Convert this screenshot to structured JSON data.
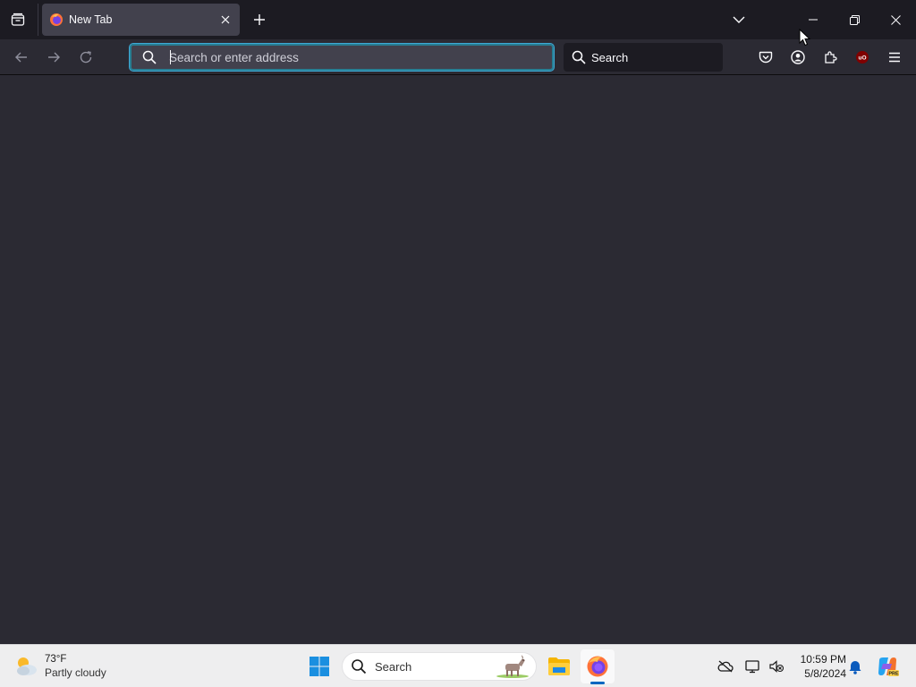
{
  "browser": {
    "tabs": [
      {
        "title": "New Tab",
        "active": true
      }
    ],
    "urlbar": {
      "placeholder": "Search or enter address",
      "value": ""
    },
    "searchbar": {
      "label": "Search"
    },
    "accent_color": "#00ddff"
  },
  "taskbar": {
    "weather": {
      "temperature": "73°F",
      "condition": "Partly cloudy"
    },
    "search_label": "Search",
    "clock": {
      "time": "10:59 PM",
      "date": "5/8/2024"
    },
    "apps": [
      "file-explorer-icon",
      "firefox-icon"
    ],
    "active_app": "firefox-icon"
  }
}
